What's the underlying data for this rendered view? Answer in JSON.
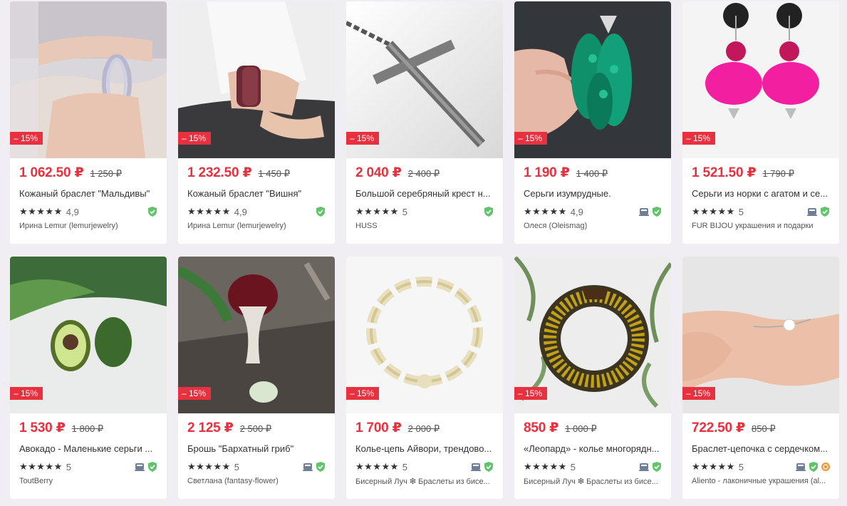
{
  "products": [
    {
      "discount": "– 15%",
      "price": "1 062.50 ₽",
      "old_price": "1 250 ₽",
      "title": "Кожаный браслет \"Мальдивы\"",
      "stars": "★★★★★",
      "rating": "4,9",
      "seller": "Ирина Lemur (lemurjewelry)",
      "icons": [
        "verified-icon"
      ]
    },
    {
      "discount": "– 15%",
      "price": "1 232.50 ₽",
      "old_price": "1 450 ₽",
      "title": "Кожаный браслет \"Вишня\"",
      "stars": "★★★★★",
      "rating": "4,9",
      "seller": "Ирина Lemur (lemurjewelry)",
      "icons": [
        "verified-icon"
      ]
    },
    {
      "discount": "– 15%",
      "price": "2 040 ₽",
      "old_price": "2 400 ₽",
      "title": "Большой серебряный крест н...",
      "stars": "★★★★★",
      "rating": "5",
      "seller": "HUSS",
      "icons": [
        "verified-icon"
      ]
    },
    {
      "discount": "– 15%",
      "price": "1 190 ₽",
      "old_price": "1 400 ₽",
      "title": "Серьги изумрудные.",
      "stars": "★★★★★",
      "rating": "4,9",
      "seller": "Олеся (Oleismag)",
      "icons": [
        "delivery-icon",
        "verified-icon"
      ]
    },
    {
      "discount": "– 15%",
      "price": "1 521.50 ₽",
      "old_price": "1 790 ₽",
      "title": "Серьги из норки с агатом и се...",
      "stars": "★★★★★",
      "rating": "5",
      "seller": "FUR BIJOU украшения и подарки",
      "icons": [
        "delivery-icon",
        "verified-icon"
      ]
    },
    {
      "discount": "– 15%",
      "price": "1 530 ₽",
      "old_price": "1 800 ₽",
      "title": "Авокадо - Маленькие серьги ...",
      "stars": "★★★★★",
      "rating": "5",
      "seller": "ToutBerry",
      "icons": [
        "delivery-icon",
        "verified-icon"
      ]
    },
    {
      "discount": "– 15%",
      "price": "2 125 ₽",
      "old_price": "2 500 ₽",
      "title": "Брошь \"Бархатный гриб\"",
      "stars": "★★★★★",
      "rating": "5",
      "seller": "Светлана (fantasy-flower)",
      "icons": [
        "delivery-icon",
        "verified-icon"
      ]
    },
    {
      "discount": "– 15%",
      "price": "1 700 ₽",
      "old_price": "2 000 ₽",
      "title": "Колье-цепь Айвори, трендово...",
      "stars": "★★★★★",
      "rating": "5",
      "seller": "Бисерный Луч ❇ Браслеты из бисе...",
      "icons": [
        "delivery-icon",
        "verified-icon"
      ]
    },
    {
      "discount": "– 15%",
      "price": "850 ₽",
      "old_price": "1 000 ₽",
      "title": "«Леопард» - колье многорядн...",
      "stars": "★★★★★",
      "rating": "5",
      "seller": "Бисерный Луч ❇ Браслеты из бисе...",
      "icons": [
        "delivery-icon",
        "verified-icon"
      ]
    },
    {
      "discount": "– 15%",
      "price": "722.50 ₽",
      "old_price": "850 ₽",
      "title": "Браслет-цепочка с сердечком...",
      "stars": "★★★★★",
      "rating": "5",
      "seller": "Aliento - лаконичные украшения (al...",
      "icons": [
        "delivery-icon",
        "verified-icon",
        "medal-icon"
      ]
    }
  ],
  "colors": {
    "accent": "#e8303f",
    "verified": "#5fc46a",
    "delivery": "#6f7f95",
    "medal": "#f09a3e",
    "background": "#f0eef3"
  }
}
